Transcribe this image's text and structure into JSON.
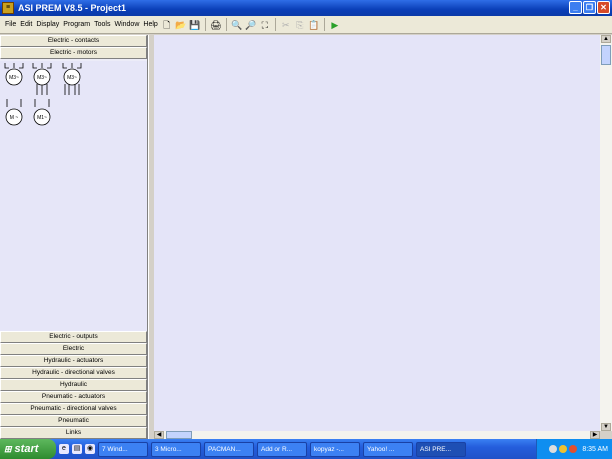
{
  "window": {
    "title": "ASI PREM V8.5 - Project1"
  },
  "menu": {
    "items": [
      "File",
      "Edit",
      "Display",
      "Program",
      "Tools",
      "Window",
      "Help"
    ]
  },
  "toolbar": {
    "buttons": [
      {
        "name": "new-file-icon",
        "glyph": "🗋"
      },
      {
        "name": "open-folder-icon",
        "glyph": "📂"
      },
      {
        "name": "save-icon",
        "glyph": "💾"
      },
      {
        "name": "print-icon",
        "glyph": "🖨"
      },
      {
        "name": "zoom-in-icon",
        "glyph": "🔍"
      },
      {
        "name": "zoom-out-icon",
        "glyph": "🔎"
      },
      {
        "name": "zoom-fit-icon",
        "glyph": "⛶"
      },
      {
        "name": "cut-icon",
        "glyph": "✂"
      },
      {
        "name": "copy-icon",
        "glyph": "⎘"
      },
      {
        "name": "paste-icon",
        "glyph": "📋"
      },
      {
        "name": "run-icon",
        "glyph": "▶"
      }
    ]
  },
  "library": {
    "top_categories": [
      "Electric - contacts",
      "Electric - motors"
    ],
    "motors": [
      "M3~",
      "M3~",
      "M3~",
      "M ~",
      "M1~"
    ],
    "bottom_categories": [
      "Electric - outputs",
      "Electric",
      "Hydraulic - actuators",
      "Hydraulic - directional valves",
      "Hydraulic",
      "Pneumatic - actuators",
      "Pneumatic - directional valves",
      "Pneumatic",
      "Links"
    ]
  },
  "taskbar": {
    "start_label": "start",
    "tasks": [
      "7 Wind...",
      "3 Micro...",
      "PACMAN...",
      "Add or R...",
      "kopyaz -...",
      "Yahoo! ...",
      "ASI PRE..."
    ],
    "clock": "8:35 AM"
  }
}
